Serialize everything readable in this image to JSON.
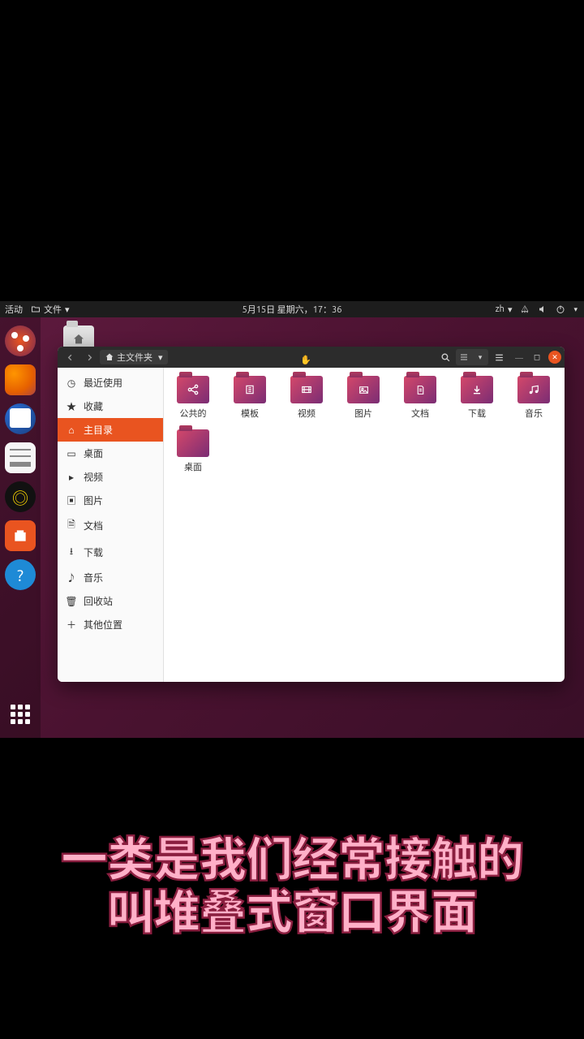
{
  "panel": {
    "activities": "活动",
    "app_menu": "文件",
    "datetime": "5月15日 星期六，17：36",
    "lang": "zh"
  },
  "dock": {
    "items": [
      "ubuntu",
      "firefox",
      "thunderbird",
      "files",
      "rhythmbox",
      "software",
      "help"
    ],
    "apps": "show-apps"
  },
  "fm": {
    "path_label": "主文件夹",
    "sidebar": [
      {
        "icon": "clock",
        "label": "最近使用"
      },
      {
        "icon": "star",
        "label": "收藏"
      },
      {
        "icon": "home",
        "label": "主目录",
        "active": true
      },
      {
        "icon": "desktop",
        "label": "桌面"
      },
      {
        "icon": "video",
        "label": "视频"
      },
      {
        "icon": "image",
        "label": "图片"
      },
      {
        "icon": "doc",
        "label": "文档"
      },
      {
        "icon": "download",
        "label": "下载"
      },
      {
        "icon": "music",
        "label": "音乐"
      },
      {
        "icon": "trash",
        "label": "回收站"
      },
      {
        "icon": "plus",
        "label": "其他位置"
      }
    ],
    "folders": [
      {
        "glyph": "share",
        "label": "公共的"
      },
      {
        "glyph": "template",
        "label": "模板"
      },
      {
        "glyph": "video",
        "label": "视频"
      },
      {
        "glyph": "image",
        "label": "图片"
      },
      {
        "glyph": "doc",
        "label": "文档"
      },
      {
        "glyph": "download",
        "label": "下载"
      },
      {
        "glyph": "music",
        "label": "音乐"
      },
      {
        "glyph": "",
        "label": "桌面"
      }
    ]
  },
  "subtitle": {
    "line1": "一类是我们经常接触的",
    "line2": "叫堆叠式窗口界面"
  }
}
